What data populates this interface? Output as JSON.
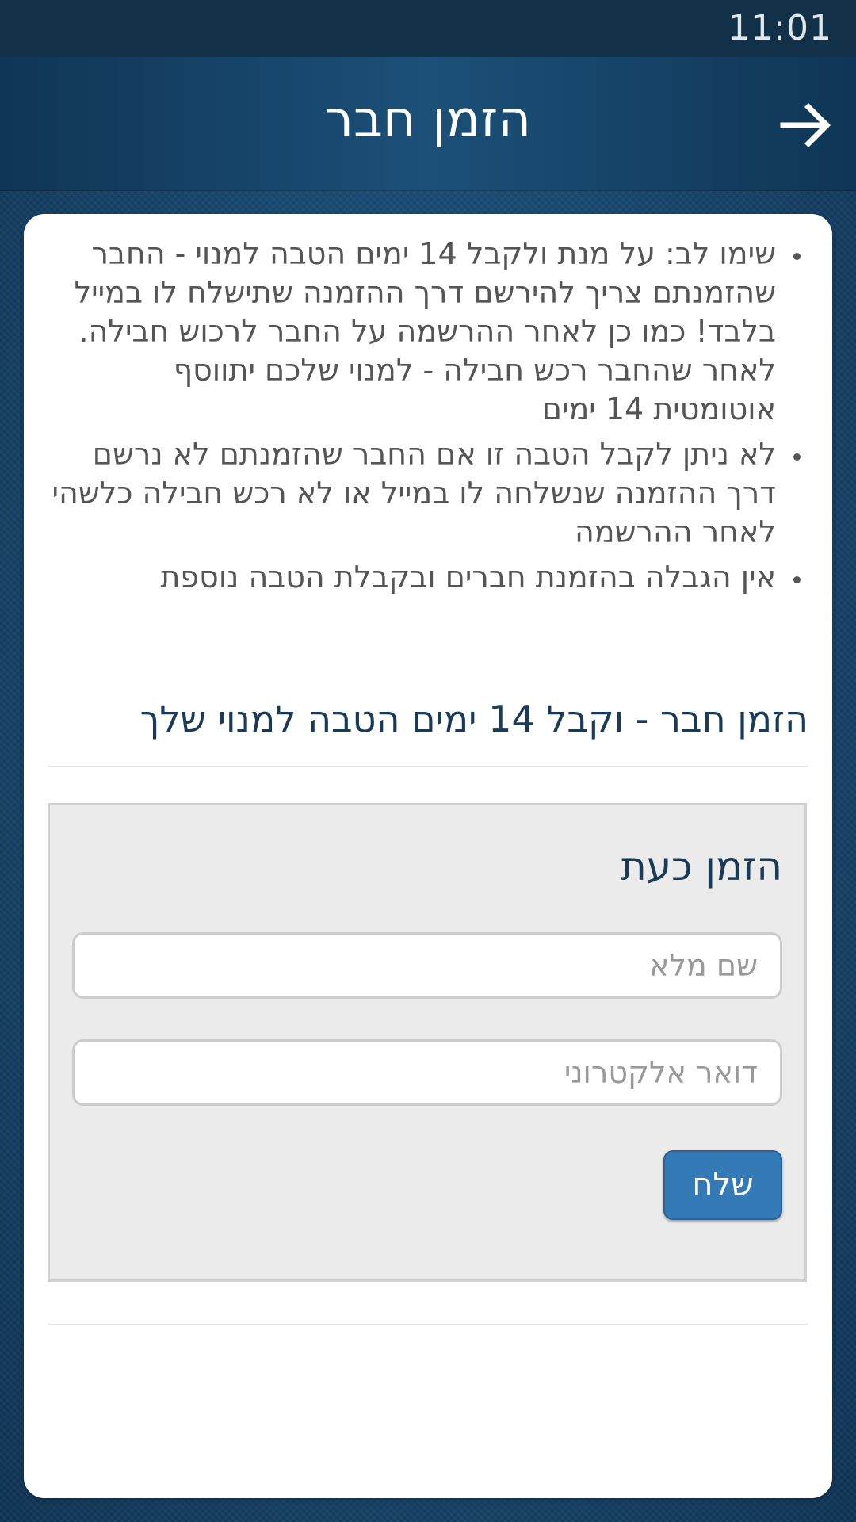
{
  "status_bar": {
    "time": "11:01"
  },
  "header": {
    "title": "הזמן חבר",
    "back_icon": "arrow-right-icon"
  },
  "notes": [
    "שימו לב: על מנת ולקבל 14 ימים הטבה למנוי - החבר שהזמנתם צריך להירשם דרך ההזמנה שתישלח לו במייל בלבד! כמו כן לאחר ההרשמה על החבר לרכוש חבילה. לאחר שהחבר רכש חבילה - למנוי שלכם יתווסף אוטומטית 14 ימים",
    "לא ניתן לקבל הטבה זו אם החבר שהזמנתם לא נרשם דרך ההזמנה שנשלחה לו במייל או לא רכש חבילה כלשהי לאחר ההרשמה",
    "אין הגבלה בהזמנת חברים ובקבלת הטבה נוספת"
  ],
  "section": {
    "title": "הזמן חבר - וקבל 14 ימים הטבה למנוי שלך"
  },
  "form": {
    "title": "הזמן כעת",
    "name_value": "",
    "name_placeholder": "שם מלא",
    "email_value": "",
    "email_placeholder": "דואר אלקטרוני",
    "submit_label": "שלח"
  },
  "colors": {
    "header_bg": "#123149",
    "accent": "#337ab7",
    "title_text": "#1a3a58",
    "body_text": "#555555"
  }
}
